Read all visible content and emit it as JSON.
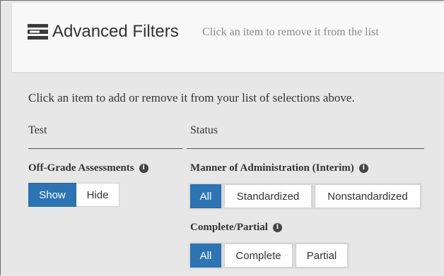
{
  "header": {
    "icon": "filter-list-icon",
    "title": "Advanced Filters",
    "subtitle": "Click an item to remove it from the list"
  },
  "instructions": "Click an item to add or remove it from your list of selections above.",
  "columns": {
    "test": {
      "heading": "Test",
      "off_grade": {
        "label": "Off-Grade Assessments",
        "options": [
          "Show",
          "Hide"
        ],
        "selected": "Show"
      }
    },
    "status": {
      "heading": "Status",
      "manner": {
        "label": "Manner of Administration (Interim)",
        "options": [
          "All",
          "Standardized",
          "Nonstandardized"
        ],
        "selected": "All"
      },
      "complete_partial": {
        "label": "Complete/Partial",
        "options": [
          "All",
          "Complete",
          "Partial"
        ],
        "selected": "All"
      }
    }
  },
  "info_icon_glyph": "i",
  "colors": {
    "accent": "#2d74b5",
    "panel": "#e7e7e7",
    "header": "#f8f8f8"
  }
}
